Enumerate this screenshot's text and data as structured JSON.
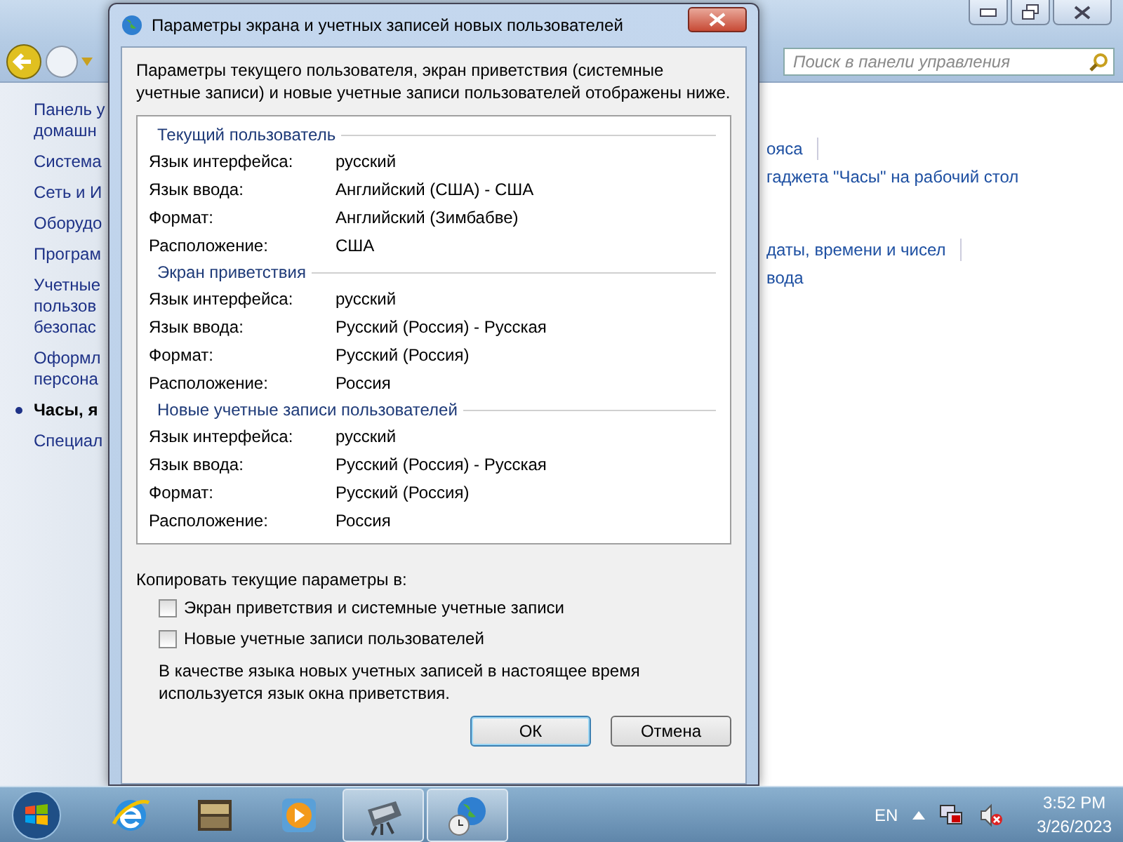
{
  "back_window": {
    "search": {
      "placeholder": "Поиск в панели управления"
    },
    "sidebar": [
      {
        "lines": [
          "Панель у",
          "домашн"
        ],
        "selected": false
      },
      {
        "lines": [
          "Система"
        ],
        "selected": false
      },
      {
        "lines": [
          "Сеть и И"
        ],
        "selected": false
      },
      {
        "lines": [
          "Оборудо"
        ],
        "selected": false
      },
      {
        "lines": [
          "Програм"
        ],
        "selected": false
      },
      {
        "lines": [
          "Учетные",
          "пользов",
          "безопас"
        ],
        "selected": false
      },
      {
        "lines": [
          "Оформл",
          "персона"
        ],
        "selected": false
      },
      {
        "lines": [
          "Часы, я"
        ],
        "selected": true
      },
      {
        "lines": [
          "Специал"
        ],
        "selected": false
      }
    ],
    "link_groups": [
      {
        "links": [
          {
            "text": "ояса",
            "separator_after": true
          },
          {
            "text": "гаджета \"Часы\" на рабочий стол",
            "separator_after": false
          }
        ]
      },
      {
        "links": [
          {
            "text": "даты, времени и чисел",
            "separator_after": true
          },
          {
            "text": "вода",
            "separator_after": false
          }
        ]
      }
    ]
  },
  "dialog": {
    "title": "Параметры экрана и учетных записей новых пользователей",
    "intro": "Параметры текущего пользователя, экран приветствия (системные учетные записи) и новые учетные записи пользователей отображены ниже.",
    "sections": [
      {
        "heading": "Текущий пользователь",
        "rows": [
          {
            "label": "Язык интерфейса:",
            "value": "русский"
          },
          {
            "label": "Язык ввода:",
            "value": "Английский (США) - США"
          },
          {
            "label": "Формат:",
            "value": "Английский (Зимбабве)"
          },
          {
            "label": "Расположение:",
            "value": "США"
          }
        ]
      },
      {
        "heading": "Экран приветствия",
        "rows": [
          {
            "label": "Язык интерфейса:",
            "value": "русский"
          },
          {
            "label": "Язык ввода:",
            "value": "Русский (Россия) - Русская"
          },
          {
            "label": "Формат:",
            "value": "Русский (Россия)"
          },
          {
            "label": "Расположение:",
            "value": "Россия"
          }
        ]
      },
      {
        "heading": "Новые учетные записи пользователей",
        "rows": [
          {
            "label": "Язык интерфейса:",
            "value": "русский"
          },
          {
            "label": "Язык ввода:",
            "value": "Русский (Россия) - Русская"
          },
          {
            "label": "Формат:",
            "value": "Русский (Россия)"
          },
          {
            "label": "Расположение:",
            "value": "Россия"
          }
        ]
      }
    ],
    "copy_label": "Копировать текущие параметры в:",
    "copy_options": [
      {
        "label": "Экран приветствия и системные учетные записи",
        "checked": false
      },
      {
        "label": "Новые учетные записи пользователей",
        "checked": false
      }
    ],
    "note": "В качестве языка новых учетных записей в настоящее время используется язык окна приветствия.",
    "buttons": [
      {
        "label": "ОК",
        "kind": "default"
      },
      {
        "label": "Отмена",
        "kind": "normal"
      }
    ]
  },
  "taskbar": {
    "items": [
      {
        "kind": "browser",
        "active": false
      },
      {
        "kind": "folder",
        "active": false
      },
      {
        "kind": "media",
        "active": false
      },
      {
        "kind": "printer",
        "active": true
      },
      {
        "kind": "globe",
        "active": true
      }
    ],
    "language": "EN",
    "time": "3:52 PM",
    "date": "3/26/2023"
  }
}
